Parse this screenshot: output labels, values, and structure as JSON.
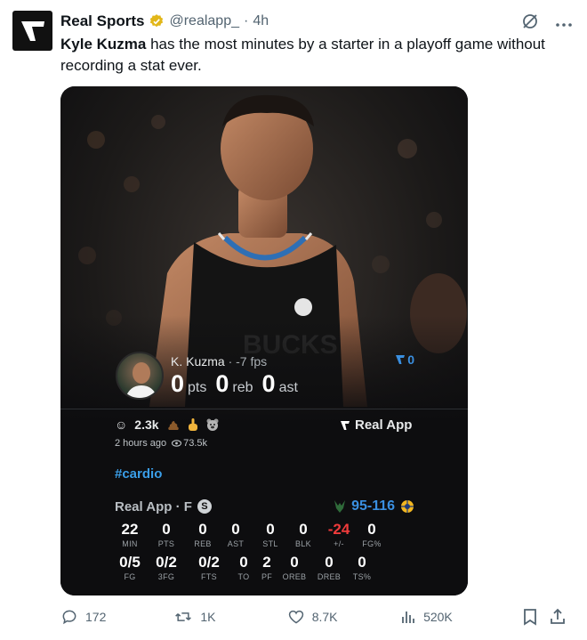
{
  "account": {
    "name": "Real Sports",
    "handle": "@realapp_",
    "separator": "·",
    "time": "4h"
  },
  "tweet": {
    "bold": "Kyle Kuzma",
    "text": " has the most minutes by a starter in a playoff game without recording a stat ever."
  },
  "card": {
    "player": {
      "name": "K. Kuzma",
      "fps": " · -7 fps"
    },
    "statline": [
      {
        "value": "0",
        "label": "pts"
      },
      {
        "value": "0",
        "label": "reb"
      },
      {
        "value": "0",
        "label": "ast"
      }
    ],
    "score_count": "0",
    "reactions": {
      "count": "2.3k"
    },
    "brand": "Real App",
    "posted": "2 hours ago",
    "views": "73.5k",
    "hashtag": "#cardio",
    "game": {
      "label": "Real App · F",
      "status_badge": "S",
      "score": "95-116"
    },
    "stats_row1": [
      {
        "v": "22",
        "k": "MIN"
      },
      {
        "v": "0",
        "k": "PTS"
      },
      {
        "v": "0",
        "k": "REB"
      },
      {
        "v": "0",
        "k": "AST"
      },
      {
        "v": "0",
        "k": "STL"
      },
      {
        "v": "0",
        "k": "BLK"
      },
      {
        "v": "-24",
        "k": "+/-"
      },
      {
        "v": "0",
        "k": "FG%"
      }
    ],
    "stats_row2": [
      {
        "v": "0/5",
        "k": "FG"
      },
      {
        "v": "0/2",
        "k": "3FG"
      },
      {
        "v": "0/2",
        "k": "FTS"
      },
      {
        "v": "0",
        "k": "TO"
      },
      {
        "v": "2",
        "k": "PF"
      },
      {
        "v": "0",
        "k": "OREB"
      },
      {
        "v": "0",
        "k": "DREB"
      },
      {
        "v": "0",
        "k": "TS%"
      }
    ]
  },
  "actions": {
    "replies": "172",
    "reposts": "1K",
    "likes": "8.7K",
    "views": "520K"
  },
  "colors": {
    "accent": "#1d9bf0",
    "negative": "#ef3b3b",
    "muted": "#536471"
  }
}
